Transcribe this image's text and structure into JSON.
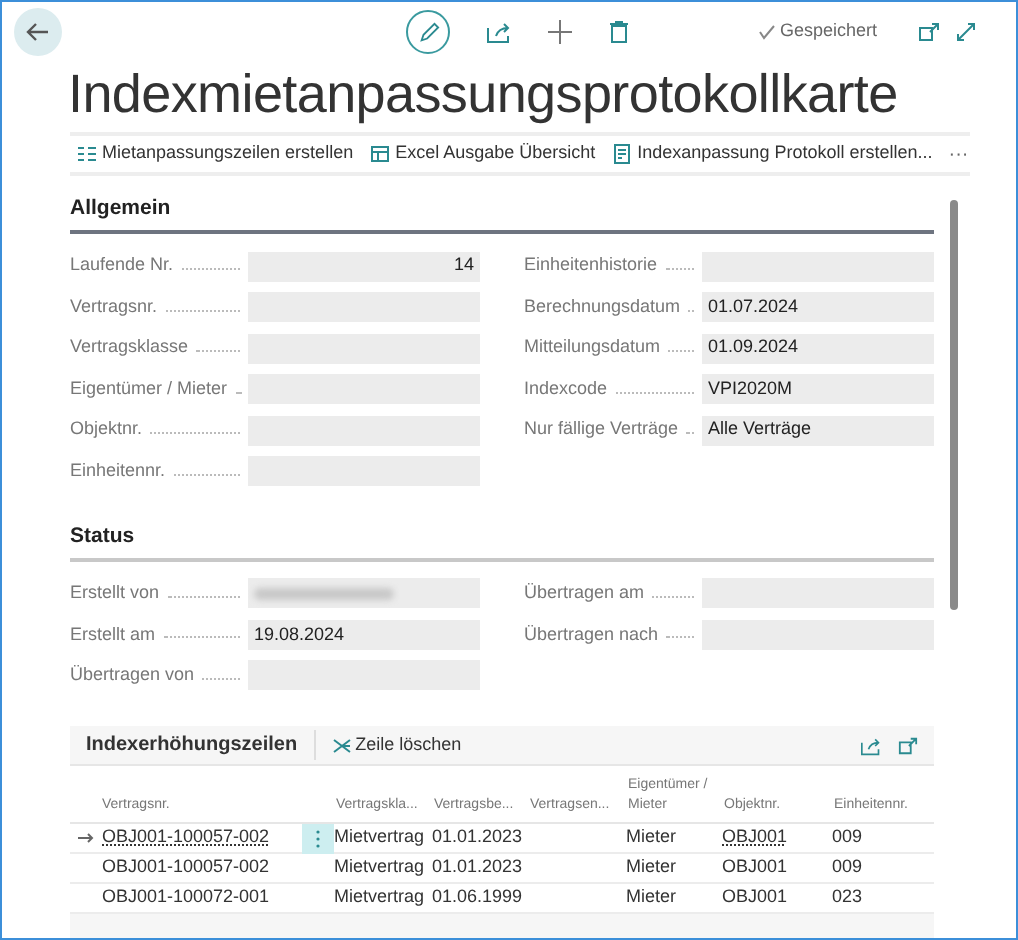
{
  "top_bar": {
    "saved_status": "Gespeichert"
  },
  "title": "Indexmietanpassungsprotokollkarte",
  "actions": [
    {
      "label": "Mietanpassungszeilen erstellen",
      "kind": "lines"
    },
    {
      "label": "Excel Ausgabe Übersicht",
      "kind": "table"
    },
    {
      "label": "Indexanpassung Protokoll erstellen...",
      "kind": "report"
    }
  ],
  "more": "···",
  "sections": [
    {
      "title": "Allgemein",
      "left": [
        {
          "label": "Laufende Nr.",
          "value": "14",
          "kind": "number"
        },
        {
          "label": "Vertragsnr.",
          "kind": "text"
        },
        {
          "label": "Vertragsklasse",
          "kind": "text"
        },
        {
          "label": "Eigentümer / Mieter",
          "kind": "text"
        },
        {
          "label": "Objektnr.",
          "kind": "text"
        },
        {
          "label": "Einheitennr.",
          "kind": "text"
        }
      ],
      "right": [
        {
          "label": "Einheitenhistorie",
          "kind": "text"
        },
        {
          "label": "Berechnungsdatum",
          "value": "01.07.2024",
          "kind": "text"
        },
        {
          "label": "Mitteilungsdatum",
          "value": "01.09.2024",
          "kind": "text"
        },
        {
          "label": "Indexcode",
          "value": "VPI2020M",
          "kind": "text"
        },
        {
          "label": "Nur fällige Verträge",
          "value": "Alle Verträge",
          "kind": "text"
        }
      ]
    },
    {
      "title": "Status",
      "left": [
        {
          "label": "Erstellt von",
          "kind": "redacted"
        },
        {
          "label": "Erstellt am",
          "value": "19.08.2024",
          "kind": "text"
        },
        {
          "label": "Übertragen von",
          "kind": "text"
        }
      ],
      "right": [
        {
          "label": "Übertragen am",
          "kind": "text"
        },
        {
          "label": "Übertragen nach",
          "kind": "text"
        }
      ]
    }
  ],
  "subpage": {
    "title": "Indexerhöhungszeilen",
    "delete_action": "Zeile löschen",
    "columns": [
      "Vertragsnr.",
      "Vertragskla...",
      "Vertragsbe...",
      "Vertragsen...",
      "Eigentümer / Mieter",
      "Objektnr.",
      "Einheitennr."
    ],
    "rows": [
      {
        "selected": true,
        "cells": [
          "OBJ001-100057-002",
          "Mietvertrag",
          "01.01.2023",
          "",
          "Mieter",
          "OBJ001",
          "009"
        ]
      },
      {
        "selected": false,
        "cells": [
          "OBJ001-100057-002",
          "Mietvertrag",
          "01.01.2023",
          "",
          "Mieter",
          "OBJ001",
          "009"
        ]
      },
      {
        "selected": false,
        "cells": [
          "OBJ001-100072-001",
          "Mietvertrag",
          "01.06.1999",
          "",
          "Mieter",
          "OBJ001",
          "023"
        ]
      }
    ]
  }
}
